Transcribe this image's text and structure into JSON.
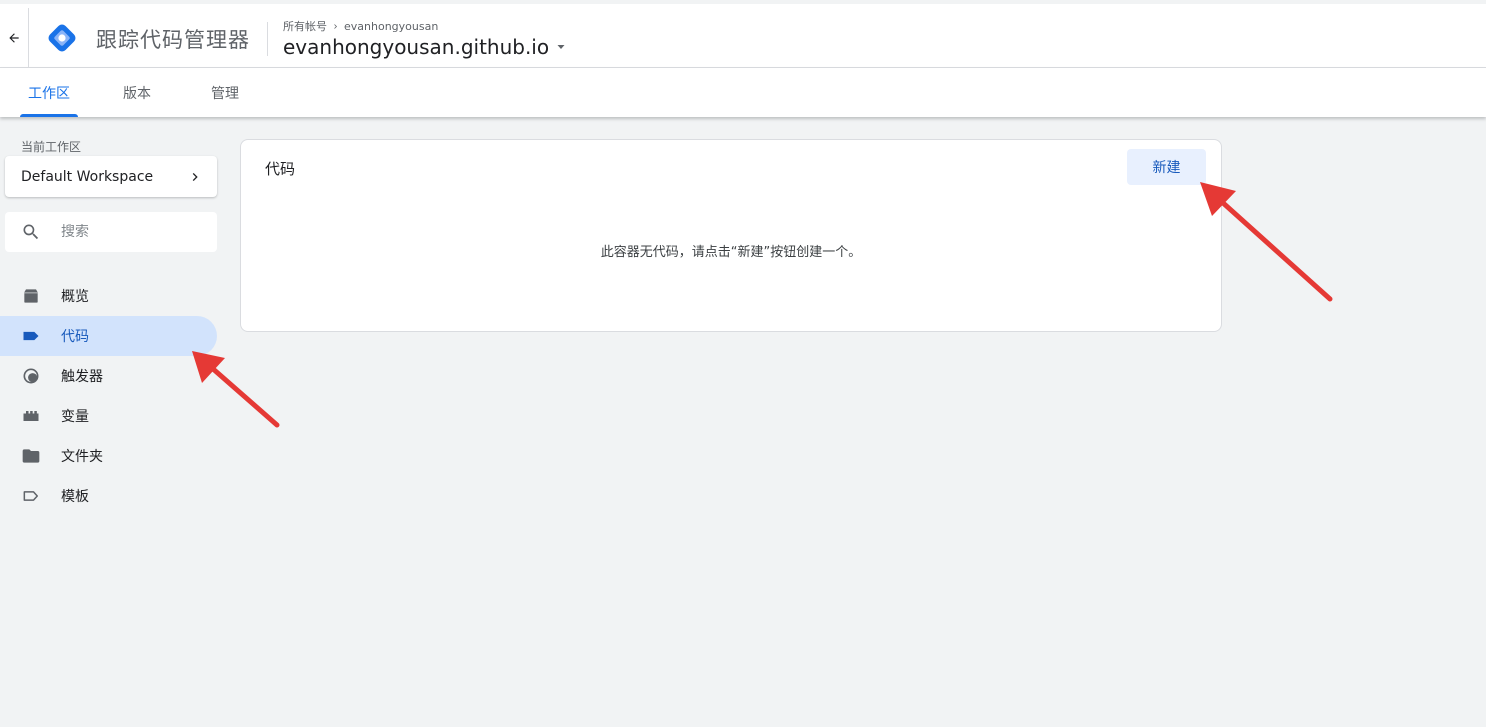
{
  "header": {
    "product_name": "跟踪代码管理器",
    "breadcrumb": {
      "parent": "所有帐号",
      "account": "evanhongyousan"
    },
    "container_name": "evanhongyousan.github.io",
    "brand_color": "#1a73e8"
  },
  "tabs": [
    {
      "label": "工作区",
      "active": true
    },
    {
      "label": "版本",
      "active": false
    },
    {
      "label": "管理",
      "active": false
    }
  ],
  "sidebar": {
    "workspace_label": "当前工作区",
    "workspace_name": "Default Workspace",
    "search_placeholder": "搜索",
    "items": [
      {
        "label": "概览",
        "icon": "overview-icon",
        "active": false
      },
      {
        "label": "代码",
        "icon": "tag-icon",
        "active": true
      },
      {
        "label": "触发器",
        "icon": "trigger-icon",
        "active": false
      },
      {
        "label": "变量",
        "icon": "variables-icon",
        "active": false
      },
      {
        "label": "文件夹",
        "icon": "folder-icon",
        "active": false
      },
      {
        "label": "模板",
        "icon": "template-icon",
        "active": false
      }
    ]
  },
  "main": {
    "card_title": "代码",
    "new_button_label": "新建",
    "empty_message": "此容器无代码，请点击“新建”按钮创建一个。"
  },
  "colors": {
    "active_nav_bg": "#d2e3fc",
    "active_nav_text": "#185abc",
    "annotation_arrow": "#e53935"
  }
}
